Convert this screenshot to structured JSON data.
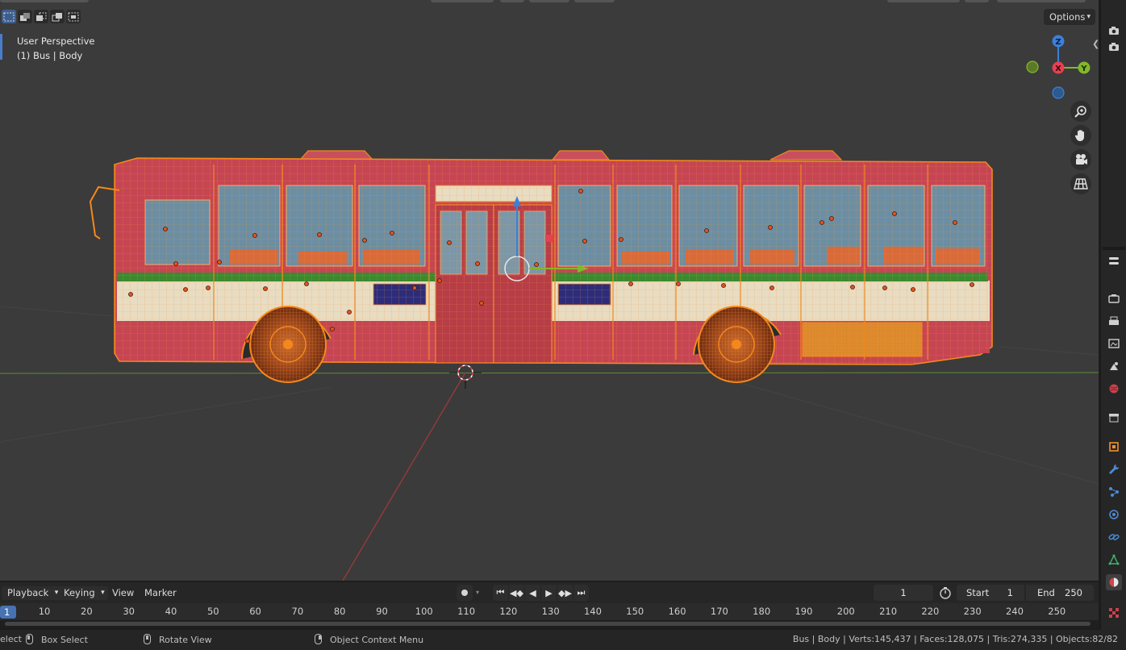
{
  "viewport": {
    "perspective_label": "User Perspective",
    "object_label": "(1) Bus | Body",
    "options_label": "Options"
  },
  "gizmo": {
    "z": "Z",
    "x": "X",
    "y": "Y"
  },
  "timeline": {
    "playback": "Playback",
    "keying": "Keying",
    "view": "View",
    "marker": "Marker",
    "current_frame": "1",
    "start_label": "Start",
    "start_value": "1",
    "end_label": "End",
    "end_value": "250",
    "ruler_current": "1",
    "ruler_ticks": [
      "10",
      "20",
      "30",
      "40",
      "50",
      "60",
      "70",
      "80",
      "90",
      "100",
      "110",
      "120",
      "130",
      "140",
      "150",
      "160",
      "170",
      "180",
      "190",
      "200",
      "210",
      "220",
      "230",
      "240",
      "250"
    ]
  },
  "status": {
    "select": "elect",
    "box_select": "Box Select",
    "rotate_view": "Rotate View",
    "context_menu": "Object Context Menu",
    "stats": "Bus | Body | Verts:145,437 | Faces:128,075 | Tris:274,335 | Objects:82/82"
  },
  "colors": {
    "selection_orange": "#f4881c",
    "bus_red": "#c4404e",
    "bus_cream": "#ece2c8",
    "stripe_green": "#3c8b2f",
    "axis_x": "#e84050",
    "axis_y": "#82b82c",
    "axis_z": "#3d7fd9",
    "accent_blue": "#4772b3"
  }
}
